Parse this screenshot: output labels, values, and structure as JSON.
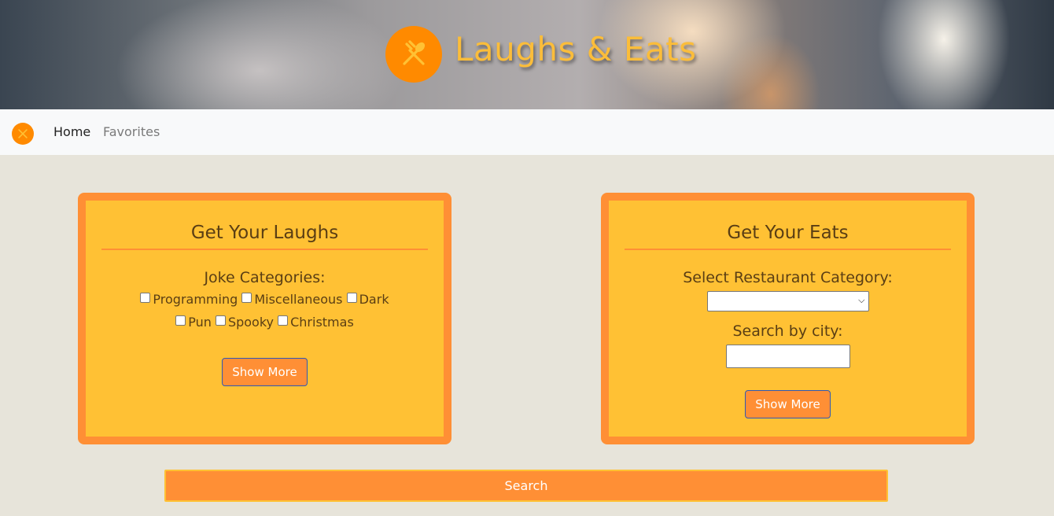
{
  "header": {
    "title": "Laughs & Eats",
    "logo_icon": "fork-spoon-icon"
  },
  "nav": {
    "items": [
      {
        "label": "Home"
      },
      {
        "label": "Favorites"
      }
    ]
  },
  "laughs": {
    "title": "Get Your Laughs",
    "categories_label": "Joke Categories:",
    "categories": [
      "Programming",
      "Miscellaneous",
      "Dark",
      "Pun",
      "Spooky",
      "Christmas"
    ],
    "button_label": "Show More"
  },
  "eats": {
    "title": "Get Your Eats",
    "category_label": "Select Restaurant Category:",
    "category_value": "",
    "city_label": "Search by city:",
    "city_value": "",
    "button_label": "Show More"
  },
  "search": {
    "label": "Search"
  },
  "colors": {
    "accent": "#ff8f35",
    "card": "#ffc134",
    "logo": "#ff8a00",
    "title": "#fbbd3a"
  }
}
